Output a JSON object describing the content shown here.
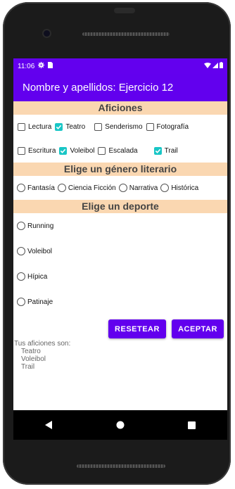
{
  "status": {
    "time": "11:06"
  },
  "appbar": {
    "title": "Nombre y apellidos: Ejercicio 12"
  },
  "aficiones": {
    "header": "Aficiones",
    "items": [
      {
        "label": "Lectura",
        "checked": false
      },
      {
        "label": "Teatro",
        "checked": true
      },
      {
        "label": "Senderismo",
        "checked": false
      },
      {
        "label": "Fotografía",
        "checked": false
      },
      {
        "label": "Escritura",
        "checked": false
      },
      {
        "label": "Voleibol",
        "checked": true
      },
      {
        "label": "Escalada",
        "checked": false
      },
      {
        "label": "Trail",
        "checked": true
      }
    ]
  },
  "genero": {
    "header": "Elige un género literario",
    "options": [
      "Fantasía",
      "Ciencia Ficción",
      "Narrativa",
      "Histórica"
    ]
  },
  "deporte": {
    "header": "Elige un deporte",
    "options": [
      "Running",
      "Voleibol",
      "Hípica",
      "Patinaje"
    ]
  },
  "buttons": {
    "reset": "RESETEAR",
    "accept": "ACEPTAR"
  },
  "summary": {
    "title": "Tus aficiones son:",
    "items": [
      "Teatro",
      "Voleibol",
      "Trail"
    ]
  },
  "colors": {
    "primary": "#6200ee",
    "section": "#fad7b1",
    "check": "#19c6c6"
  },
  "icons": {
    "settings": "gear-icon",
    "sim": "sim-card-icon",
    "wifi": "wifi-icon",
    "signal": "signal-icon",
    "battery": "battery-icon",
    "back": "back-icon",
    "home": "home-icon",
    "recents": "recents-icon"
  }
}
